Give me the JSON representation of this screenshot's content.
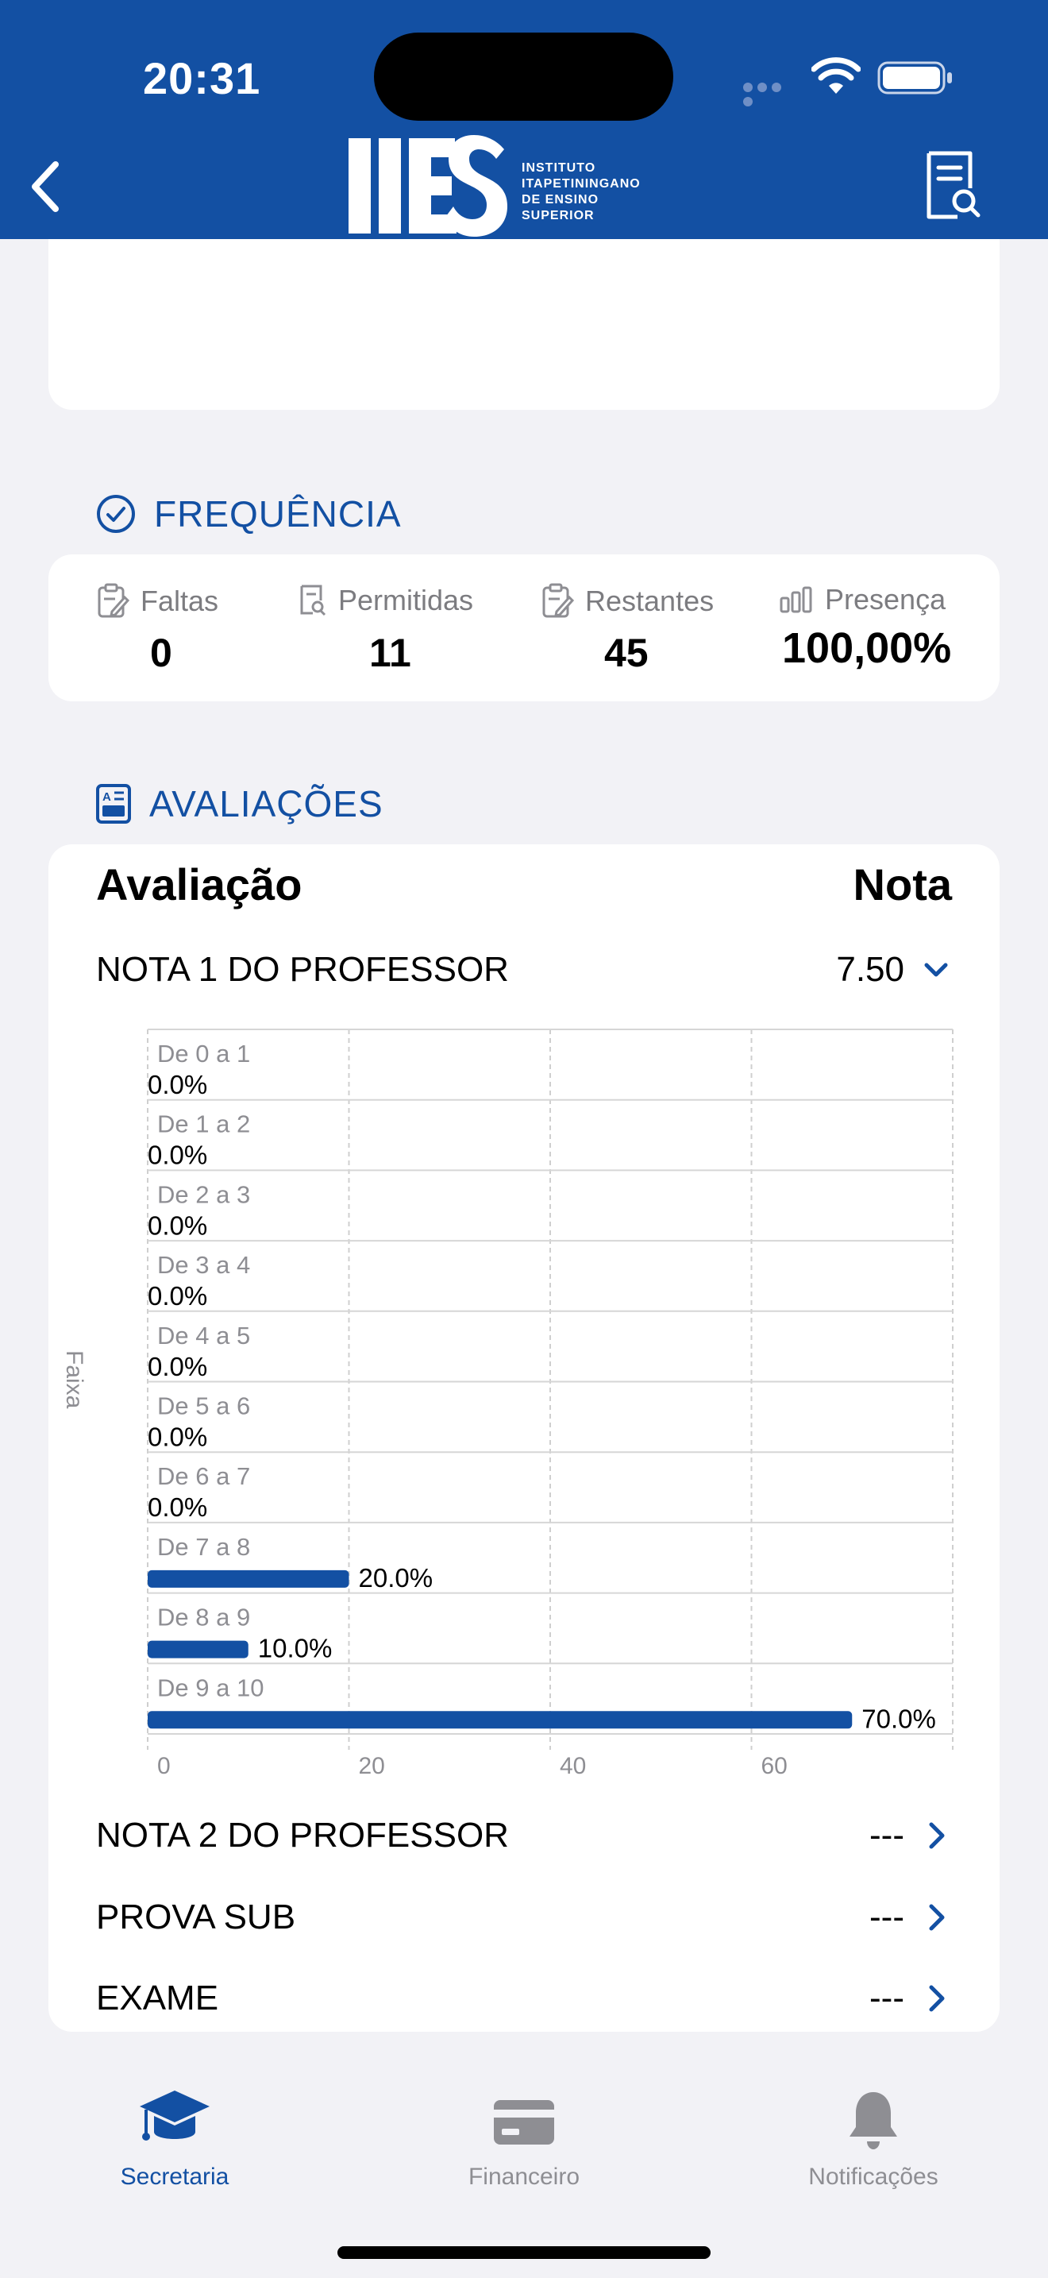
{
  "status_bar": {
    "time": "20:31"
  },
  "header": {
    "logo_text": "IIES",
    "logo_subtitle": [
      "INSTITUTO",
      "ITAPETININGANO",
      "DE ENSINO",
      "SUPERIOR"
    ],
    "back_icon": "chevron-left-icon",
    "right_icon": "document-search-icon"
  },
  "frequency": {
    "title": "FREQUÊNCIA",
    "items": [
      {
        "label": "Faltas",
        "value": "0",
        "icon": "clipboard-edit-icon"
      },
      {
        "label": "Permitidas",
        "value": "11",
        "icon": "document-search-icon"
      },
      {
        "label": "Restantes",
        "value": "45",
        "icon": "clipboard-edit-icon"
      },
      {
        "label": "Presença",
        "value": "100,00%",
        "icon": "bar-chart-icon"
      }
    ]
  },
  "evaluations": {
    "title": "AVALIAÇÕES",
    "col_name": "Avaliação",
    "col_grade": "Nota",
    "rows": [
      {
        "name": "NOTA 1 DO PROFESSOR",
        "grade": "7.50",
        "icon": "chevron-down-icon"
      },
      {
        "name": "NOTA 2 DO PROFESSOR",
        "grade": "---",
        "icon": "chevron-right-icon"
      },
      {
        "name": "PROVA SUB",
        "grade": "---",
        "icon": "chevron-right-icon"
      },
      {
        "name": "EXAME",
        "grade": "---",
        "icon": "chevron-right-icon"
      }
    ]
  },
  "chart_data": {
    "type": "bar",
    "orientation": "horizontal",
    "ylabel": "Faixa",
    "categories": [
      "De 0 a 1",
      "De 1 a 2",
      "De 2 a 3",
      "De 3 a 4",
      "De 4 a 5",
      "De 5 a 6",
      "De 6 a 7",
      "De 7 a 8",
      "De 8 a 9",
      "De 9 a 10"
    ],
    "values": [
      0,
      0,
      0,
      0,
      0,
      0,
      0,
      20,
      10,
      70
    ],
    "value_labels": [
      "0.0%",
      "0.0%",
      "0.0%",
      "0.0%",
      "0.0%",
      "0.0%",
      "0.0%",
      "20.0%",
      "10.0%",
      "70.0%"
    ],
    "xticks": [
      "0",
      "20",
      "40",
      "60"
    ],
    "xlim": [
      0,
      80
    ],
    "bar_color": "#1350a3",
    "grid": true
  },
  "tabbar": {
    "items": [
      {
        "label": "Secretaria",
        "icon": "graduation-cap-icon",
        "active": true
      },
      {
        "label": "Financeiro",
        "icon": "credit-card-icon",
        "active": false
      },
      {
        "label": "Notificações",
        "icon": "bell-icon",
        "active": false
      }
    ]
  },
  "colors": {
    "brand": "#1350a3",
    "background": "#f2f2f6",
    "card": "#ffffff",
    "muted": "#8e8e93"
  }
}
